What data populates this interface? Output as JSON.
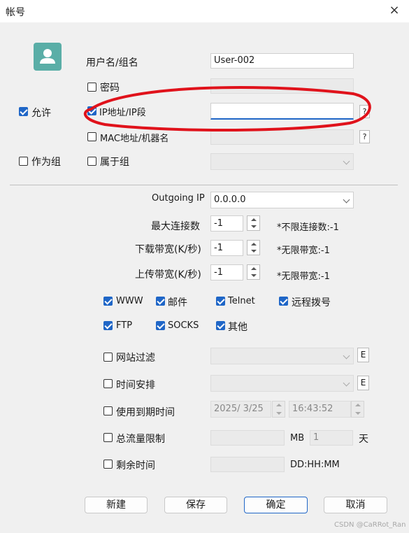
{
  "window": {
    "title": "帐号",
    "close_icon": "×"
  },
  "account": {
    "username_label": "用户名/组名",
    "username_value": "User-002",
    "password_label": "密码",
    "allow_label": "允许",
    "ip_label": "IP地址/IP段",
    "ip_value": "",
    "mac_label": "MAC地址/机器名",
    "help_glyph": "?",
    "group_label": "作为组",
    "belongs_label": "属于组"
  },
  "settings": {
    "outgoing_ip_label": "Outgoing IP",
    "outgoing_ip_value": "0.0.0.0",
    "max_conn_label": "最大连接数",
    "max_conn_value": "-1",
    "max_conn_hint": "*不限连接数:-1",
    "download_label": "下载带宽(K/秒)",
    "download_value": "-1",
    "download_hint": "*无限带宽:-1",
    "upload_label": "上传带宽(K/秒)",
    "upload_value": "-1",
    "upload_hint": "*无限带宽:-1"
  },
  "services": {
    "www": "WWW",
    "mail": "邮件",
    "telnet": "Telnet",
    "dialup": "远程拨号",
    "ftp": "FTP",
    "socks": "SOCKS",
    "other": "其他"
  },
  "limits": {
    "site_filter_label": "网站过滤",
    "schedule_label": "时间安排",
    "edit_glyph": "E",
    "expire_label": "使用到期时间",
    "expire_date": "2025/  3/25",
    "expire_time": "16:43:52",
    "traffic_label": "总流量限制",
    "traffic_unit": "MB",
    "traffic_days": "1",
    "days_unit": "天",
    "remaining_label": "剩余时间",
    "remaining_format": "DD:HH:MM"
  },
  "buttons": {
    "new": "新建",
    "save": "保存",
    "ok": "确定",
    "cancel": "取消"
  },
  "watermark": "CSDN @CaRRot_Ran",
  "colors": {
    "accent": "#1f66c7",
    "avatar_bg": "#5aaea7",
    "annotation_red": "#e0121b"
  }
}
